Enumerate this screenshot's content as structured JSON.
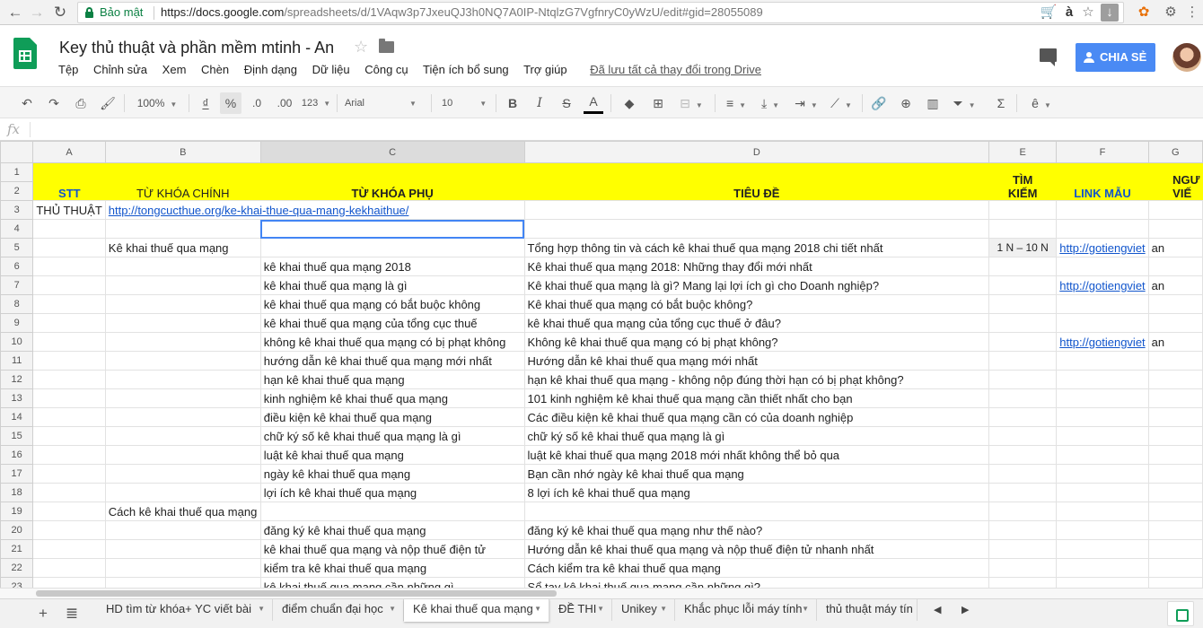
{
  "browser": {
    "secure_label": "Bảo mật",
    "url_host": "https://docs.google.com",
    "url_rest": "/spreadsheets/d/1VAqw3p7JxeuQJ3h0NQ7A0IP-NtqlzG7VgfnryC0yWzU/edit#gid=28055089",
    "ext_a_label": "à"
  },
  "app": {
    "title": "Key thủ thuật và phần mềm mtinh - An",
    "menu": [
      "Tệp",
      "Chỉnh sửa",
      "Xem",
      "Chèn",
      "Định dạng",
      "Dữ liệu",
      "Công cụ",
      "Tiện ích bổ sung",
      "Trợ giúp"
    ],
    "saved_status": "Đã lưu tất cả thay đổi trong Drive",
    "share_label": "CHIA SẺ"
  },
  "toolbar": {
    "zoom": "100%",
    "currency": "₫",
    "percent": "%",
    "dec_less": ".0",
    "dec_more": ".00",
    "num_format": "123",
    "font": "Arial",
    "font_size": "10",
    "bold": "B",
    "italic": "I",
    "strike": "S",
    "text_color": "A",
    "sum": "Σ",
    "input_tool": "ê"
  },
  "formula_bar": {
    "fx": "fx",
    "value": ""
  },
  "columns": [
    "A",
    "B",
    "C",
    "D",
    "E",
    "F",
    "G"
  ],
  "header": {
    "stt": "STT",
    "tu_khoa_chinh": "TỪ KHÓA CHÍNH",
    "tu_khoa_phu": "TỪ KHÓA PHỤ",
    "tieu_de": "TIÊU ĐỀ",
    "tim_kiem_1": "TÌM",
    "tim_kiem_2": "KIẾM",
    "link_mau": "LINK MẪU",
    "g_1": "NGƯ",
    "g_2": "VIẾ"
  },
  "rows": [
    {
      "n": "3",
      "a": "THỦ THUẬT",
      "b": "http://tongcucthue.org/ke-khai-thue-qua-mang-kekhaithue/",
      "c": "",
      "d": "",
      "e": "",
      "f": "",
      "g": ""
    },
    {
      "n": "4",
      "a": "",
      "b": "",
      "c": "",
      "d": "",
      "e": "",
      "f": "",
      "g": ""
    },
    {
      "n": "5",
      "a": "",
      "b": "Kê khai thuế qua mạng",
      "c": "",
      "d": "Tổng hợp thông tin và cách kê khai thuế qua mạng 2018 chi tiết nhất",
      "e": "1 N – 10 N",
      "f": "http://gotiengviet",
      "g": "an"
    },
    {
      "n": "6",
      "a": "",
      "b": "",
      "c": "kê khai thuế qua mạng 2018",
      "d": "Kê khai thuế qua mạng 2018: Những thay đổi mới nhất",
      "e": "",
      "f": "",
      "g": ""
    },
    {
      "n": "7",
      "a": "",
      "b": "",
      "c": "kê khai thuế qua mạng là gì",
      "d": "Kê khai thuế qua mạng là gì? Mang lại lợi ích gì cho Doanh nghiệp?",
      "e": "",
      "f": "http://gotiengviet",
      "g": "an"
    },
    {
      "n": "8",
      "a": "",
      "b": "",
      "c": "kê khai thuế qua mạng có bắt buộc không",
      "d": "Kê khai thuế qua mạng có bắt buộc không?",
      "e": "",
      "f": "",
      "g": ""
    },
    {
      "n": "9",
      "a": "",
      "b": "",
      "c": "kê khai thuế qua mạng của tổng cục thuế",
      "d": "kê khai thuế qua mạng của tổng cục thuế ở đâu?",
      "e": "",
      "f": "",
      "g": ""
    },
    {
      "n": "10",
      "a": "",
      "b": "",
      "c": "không kê khai thuế qua mạng có bị phạt không",
      "d": "Không kê khai thuế qua mạng có bị phạt không?",
      "e": "",
      "f": "http://gotiengviet",
      "g": "an"
    },
    {
      "n": "11",
      "a": "",
      "b": "",
      "c": "hướng dẫn kê khai thuế qua mạng mới nhất",
      "d": "Hướng dẫn kê khai thuế qua mạng mới nhất",
      "e": "",
      "f": "",
      "g": ""
    },
    {
      "n": "12",
      "a": "",
      "b": "",
      "c": "hạn kê khai thuế qua mạng",
      "d": "hạn kê khai thuế qua mạng - không nộp đúng thời hạn có bị phạt không?",
      "e": "",
      "f": "",
      "g": ""
    },
    {
      "n": "13",
      "a": "",
      "b": "",
      "c": "kinh nghiệm kê khai thuế qua mạng",
      "d": "101 kinh nghiệm kê khai thuế qua mạng cần thiết nhất cho bạn",
      "e": "",
      "f": "",
      "g": ""
    },
    {
      "n": "14",
      "a": "",
      "b": "",
      "c": "điều kiện kê khai thuế qua mạng",
      "d": "Các điều kiện kê khai thuế qua mạng cần có của doanh nghiệp",
      "e": "",
      "f": "",
      "g": ""
    },
    {
      "n": "15",
      "a": "",
      "b": "",
      "c": "chữ ký số kê khai thuế qua mạng là gì",
      "d": "chữ ký số kê khai thuế qua mạng là gì",
      "e": "",
      "f": "",
      "g": ""
    },
    {
      "n": "16",
      "a": "",
      "b": "",
      "c": "luật kê khai thuế qua mạng",
      "d": "luật kê khai thuế qua mạng 2018 mới nhất không thể bỏ qua",
      "e": "",
      "f": "",
      "g": ""
    },
    {
      "n": "17",
      "a": "",
      "b": "",
      "c": "ngày kê khai thuế qua mạng",
      "d": "Bạn cần nhớ ngày kê khai thuế qua mạng",
      "e": "",
      "f": "",
      "g": ""
    },
    {
      "n": "18",
      "a": "",
      "b": "",
      "c": "lợi ích kê khai thuế qua mạng",
      "d": "8 lợi ích kê khai thuế qua mạng",
      "e": "",
      "f": "",
      "g": ""
    },
    {
      "n": "19",
      "a": "",
      "b": "Cách kê khai thuế qua mạng",
      "c": "",
      "d": "",
      "e": "",
      "f": "",
      "g": ""
    },
    {
      "n": "20",
      "a": "",
      "b": "",
      "c": "đăng ký kê khai thuế qua mạng",
      "d": "đăng ký kê khai thuế qua mạng như thế nào?",
      "e": "",
      "f": "",
      "g": ""
    },
    {
      "n": "21",
      "a": "",
      "b": "",
      "c": "kê khai thuế qua mạng và nộp thuế điện tử",
      "d": "Hướng dẫn kê khai thuế qua mạng và nộp thuế điện tử nhanh nhất",
      "e": "",
      "f": "",
      "g": ""
    },
    {
      "n": "22",
      "a": "",
      "b": "",
      "c": "kiểm tra kê khai thuế qua mạng",
      "d": "Cách kiểm tra kê khai thuế qua mạng",
      "e": "",
      "f": "",
      "g": ""
    },
    {
      "n": "23",
      "a": "",
      "b": "",
      "c": "kê khai thuế qua mạng cần những gì",
      "d": "Sổ tay kê khai thuế qua mạng cần những gì?",
      "e": "",
      "f": "",
      "g": ""
    }
  ],
  "sheet_tabs": [
    "HD tìm từ khóa+ YC viết bài",
    "điểm chuẩn đại học",
    "Kê khai thuế qua mạng",
    "ĐỀ THI",
    "Unikey",
    "Khắc phục lỗi máy tính",
    "thủ thuật máy tín"
  ],
  "active_tab_index": 2
}
